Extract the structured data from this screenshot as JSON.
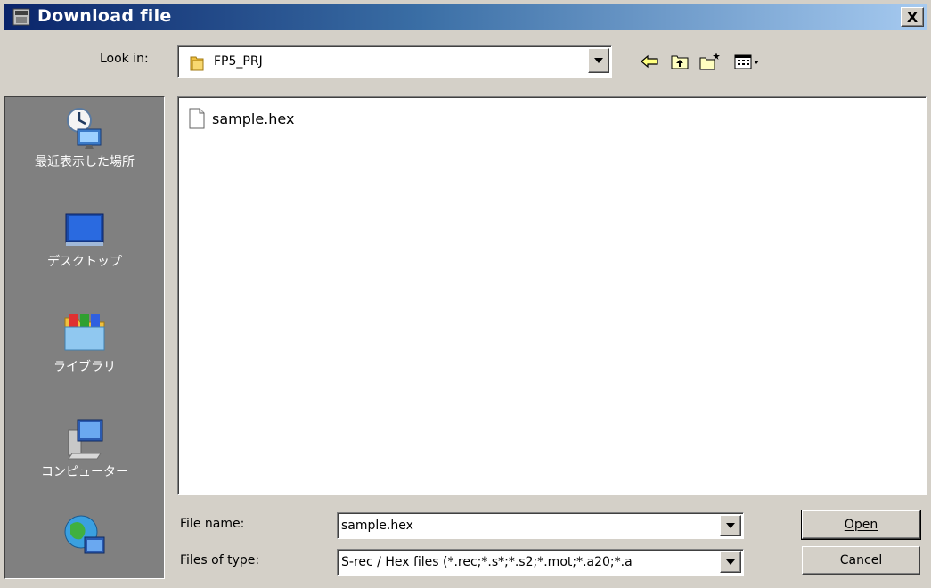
{
  "window": {
    "title": "Download file",
    "close_label": "X"
  },
  "look_in": {
    "label": "Look in:",
    "value": "FP5_PRJ"
  },
  "toolbar": {
    "icons": [
      "back-arrow-icon",
      "up-folder-icon",
      "new-folder-icon",
      "view-menu-icon"
    ]
  },
  "places": [
    {
      "label": "最近表示した場所",
      "icon": "recent-places-icon"
    },
    {
      "label": "デスクトップ",
      "icon": "desktop-icon"
    },
    {
      "label": "ライブラリ",
      "icon": "libraries-icon"
    },
    {
      "label": "コンピューター",
      "icon": "computer-icon"
    },
    {
      "label": "",
      "icon": "network-icon"
    }
  ],
  "files": [
    {
      "name": "sample.hex",
      "icon": "file-icon"
    }
  ],
  "file_name": {
    "label": "File name:",
    "value": "sample.hex"
  },
  "file_type": {
    "label": "Files of type:",
    "value": "S-rec / Hex files (*.rec;*.s*;*.s2;*.mot;*.a20;*.a"
  },
  "buttons": {
    "open": "Open",
    "cancel": "Cancel"
  },
  "colors": {
    "titlebar_start": "#0a246a",
    "titlebar_end": "#a6caf0",
    "face": "#d4d0c8",
    "places_bg": "#808080"
  }
}
